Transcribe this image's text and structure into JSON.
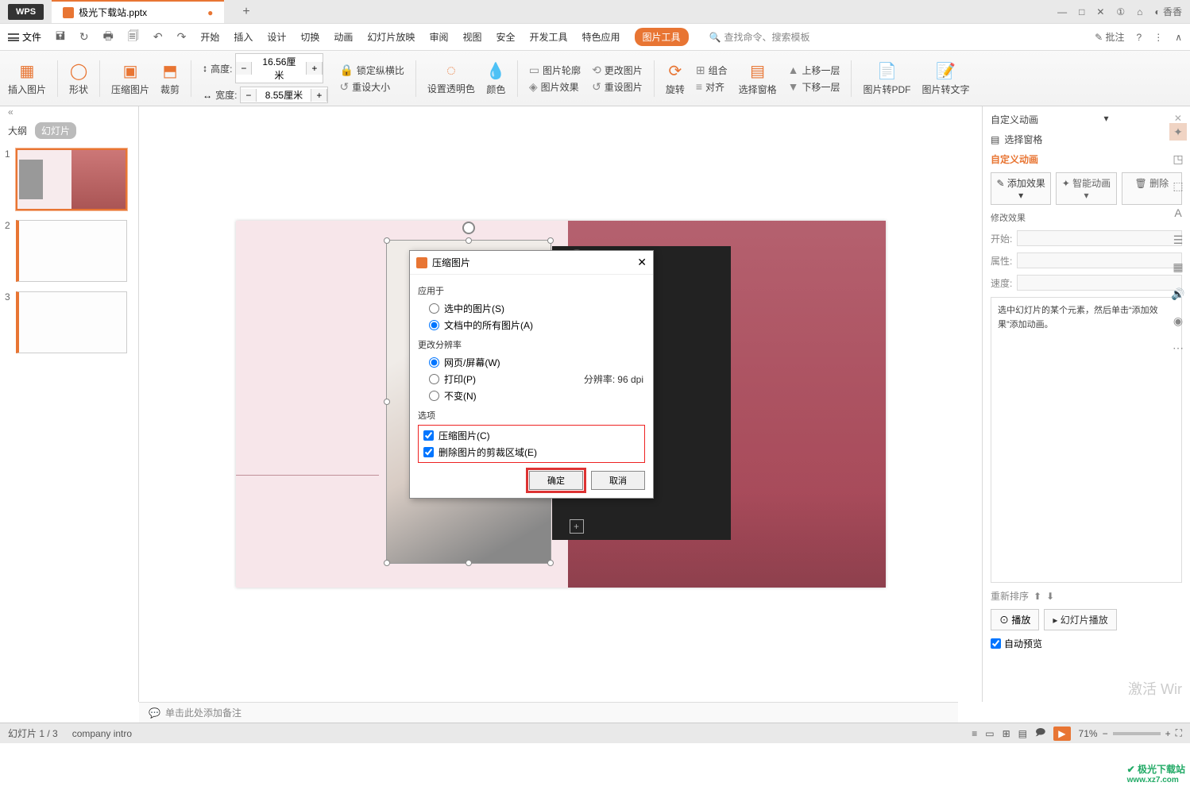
{
  "title": {
    "wps": "WPS",
    "filename": "极光下载站.pptx",
    "user": "香香"
  },
  "menu": {
    "file": "文件",
    "items": [
      "开始",
      "插入",
      "设计",
      "切换",
      "动画",
      "幻灯片放映",
      "审阅",
      "视图",
      "安全",
      "开发工具",
      "特色应用"
    ],
    "pictool": "图片工具",
    "search_placeholder": "查找命令、搜索模板",
    "annotate": "批注"
  },
  "ribbon": {
    "insert_pic": "插入图片",
    "shapes": "形状",
    "compress": "压缩图片",
    "crop": "裁剪",
    "height_lbl": "高度:",
    "width_lbl": "宽度:",
    "height": "16.56厘米",
    "width": "8.55厘米",
    "lock": "锁定纵横比",
    "reset_size": "重设大小",
    "transparency": "设置透明色",
    "color": "颜色",
    "outline": "图片轮廓",
    "effect": "图片效果",
    "change": "更改图片",
    "reset_pic": "重设图片",
    "rotate": "旋转",
    "group": "组合",
    "align": "对齐",
    "selpane": "选择窗格",
    "up": "上移一层",
    "down": "下移一层",
    "pdf": "图片转PDF",
    "txt": "图片转文字"
  },
  "thumbs": {
    "outline": "大纲",
    "slides": "幻灯片",
    "nums": [
      "1",
      "2",
      "3"
    ]
  },
  "dialog": {
    "title": "压缩图片",
    "apply": "应用于",
    "opt_sel": "选中的图片(S)",
    "opt_all": "文档中的所有图片(A)",
    "res": "更改分辨率",
    "res_web": "网页/屏幕(W)",
    "res_print": "打印(P)",
    "res_none": "不变(N)",
    "dpi_lbl": "分辨率:",
    "dpi": "96 dpi",
    "options": "选项",
    "chk_compress": "压缩图片(C)",
    "chk_delete": "删除图片的剪裁区域(E)",
    "ok": "确定",
    "cancel": "取消"
  },
  "anim": {
    "title": "自定义动画",
    "selpane": "选择窗格",
    "heading": "自定义动画",
    "add": "添加效果",
    "smart": "智能动画",
    "del": "删除",
    "modify": "修改效果",
    "start": "开始:",
    "prop": "属性:",
    "speed": "速度:",
    "hint": "选中幻灯片的某个元素，然后单击“添加效果”添加动画。",
    "reorder": "重新排序",
    "play": "播放",
    "slideshow": "幻灯片播放",
    "auto": "自动预览"
  },
  "notes": "单击此处添加备注",
  "status": {
    "pos": "幻灯片 1 / 3",
    "theme": "company intro",
    "zoom": "71%",
    "activate": "激活 Wir"
  },
  "watermark": {
    "name": "极光下载站",
    "url": "www.xz7.com"
  }
}
